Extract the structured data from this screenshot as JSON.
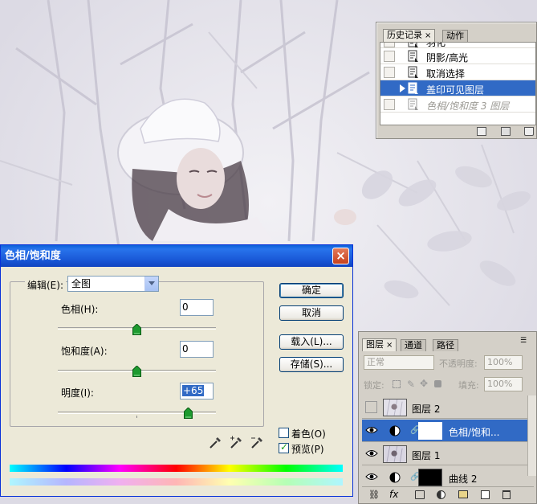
{
  "history": {
    "tabs": [
      "历史记录",
      "动作"
    ],
    "close_glyph": "×",
    "items": [
      {
        "label": "羽化",
        "state": "normal"
      },
      {
        "label": "阴影/高光",
        "state": "normal"
      },
      {
        "label": "取消选择",
        "state": "normal"
      },
      {
        "label": "盖印可见图层",
        "state": "selected"
      },
      {
        "label": "色相/饱和度 3 图层",
        "state": "dimmed"
      }
    ]
  },
  "dialog": {
    "title": "色相/饱和度",
    "close_glyph": "×",
    "edit_label": "编辑(E):",
    "edit_value": "全图",
    "fields": [
      {
        "label": "色相(H):",
        "value": "0",
        "slider": 0
      },
      {
        "label": "饱和度(A):",
        "value": "0",
        "slider": 0
      },
      {
        "label": "明度(I):",
        "value": "+65",
        "slider": 65
      }
    ],
    "buttons": [
      "确定",
      "取消",
      "载入(L)...",
      "存储(S)..."
    ],
    "colorize_label": "着色(O)",
    "colorize_checked": false,
    "preview_label": "预览(P)",
    "preview_checked": true
  },
  "layers": {
    "tabs": [
      "图层",
      "通道",
      "路径"
    ],
    "close_glyph": "×",
    "blend_mode": "正常",
    "opacity_label": "不透明度:",
    "opacity_value": "100%",
    "lock_label": "锁定:",
    "fill_label": "填充:",
    "fill_value": "100%",
    "rows": [
      {
        "name": "图层 2",
        "visible": false,
        "selected": false
      },
      {
        "name": "色相/饱和...",
        "visible": true,
        "selected": true
      },
      {
        "name": "图层 1",
        "visible": true,
        "selected": false
      },
      {
        "name": "曲线 2",
        "visible": true,
        "selected": false
      }
    ]
  },
  "colors": {
    "selection": "#316ac5",
    "title_bar": "#1957d6",
    "dialog_face": "#ece9d8",
    "panel_face": "#d4d0c8"
  }
}
